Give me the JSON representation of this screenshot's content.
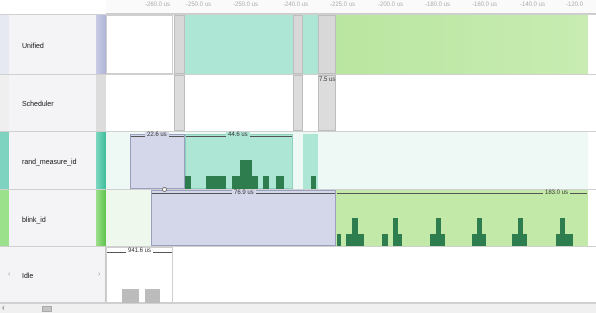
{
  "ruler": {
    "ticks": [
      "-260.0 us",
      "-250.0 us",
      "-250.0 us",
      "-240.0 us",
      "-225.0 us",
      "-200.0 us",
      "-180.0 us",
      "-160.0 us",
      "-140.0 us",
      "-120.0"
    ]
  },
  "tracks": [
    {
      "name": "Unified"
    },
    {
      "name": "Scheduler"
    },
    {
      "name": "rand_measure_id"
    },
    {
      "name": "blink_id"
    },
    {
      "name": "Idle"
    }
  ],
  "durations": {
    "scheduler": "7.5 us",
    "rand_a": "22.6 us",
    "rand_b": "44.6 us",
    "blink_a": "76.9 us",
    "blink_b": "183.0 us",
    "idle": "941.6 us"
  },
  "colors": {
    "teal": "#aee6d6",
    "green": "#c3e9a8",
    "lavender": "#d4d6ea",
    "dark_green": "#2e7d4f"
  }
}
